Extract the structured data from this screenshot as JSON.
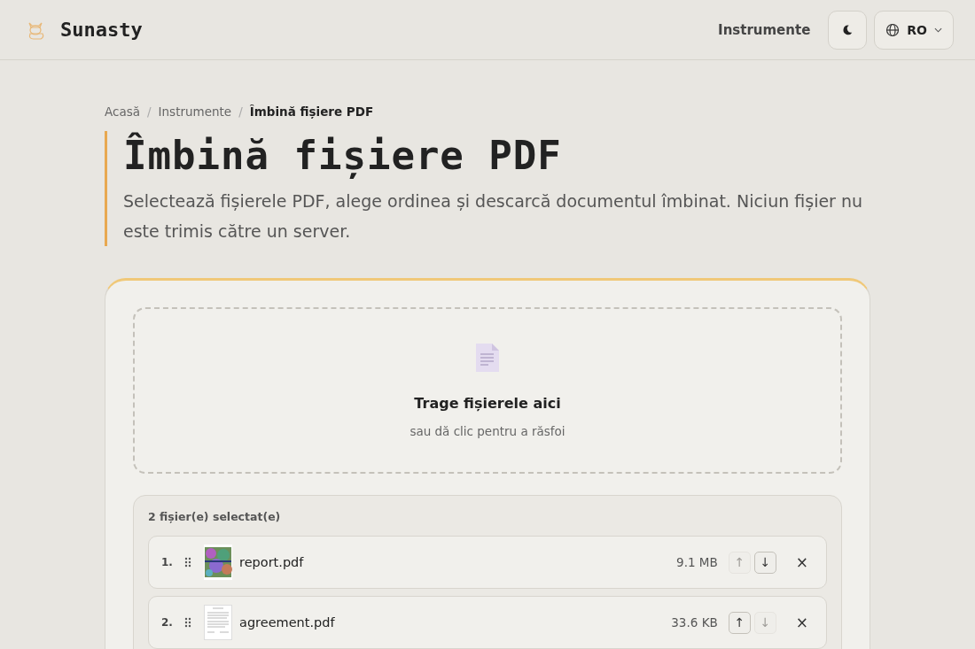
{
  "header": {
    "brand": "Sunasty",
    "nav_link": "Instrumente",
    "language": "RO"
  },
  "breadcrumb": [
    {
      "label": "Acasă",
      "current": false
    },
    {
      "label": "Instrumente",
      "current": false
    },
    {
      "label": "Îmbină fișiere PDF",
      "current": true
    }
  ],
  "breadcrumb_separator": "/",
  "title": "Îmbină fișiere PDF",
  "description": "Selectează fișierele PDF, alege ordinea și descarcă documentul îmbinat. Niciun fișier nu este trimis către un server.",
  "dropzone": {
    "title": "Trage fișierele aici",
    "subtitle": "sau dă clic pentru a răsfoi"
  },
  "file_list": {
    "count_label": "2 fișier(e) selectat(e)",
    "up_symbol": "↑",
    "down_symbol": "↓",
    "remove_symbol": "×",
    "files": [
      {
        "index": "1.",
        "name": "report.pdf",
        "size": "9.1 MB",
        "kind": "picture",
        "up_disabled": true,
        "down_disabled": false
      },
      {
        "index": "2.",
        "name": "agreement.pdf",
        "size": "33.6 KB",
        "kind": "document",
        "up_disabled": false,
        "down_disabled": true
      }
    ]
  }
}
